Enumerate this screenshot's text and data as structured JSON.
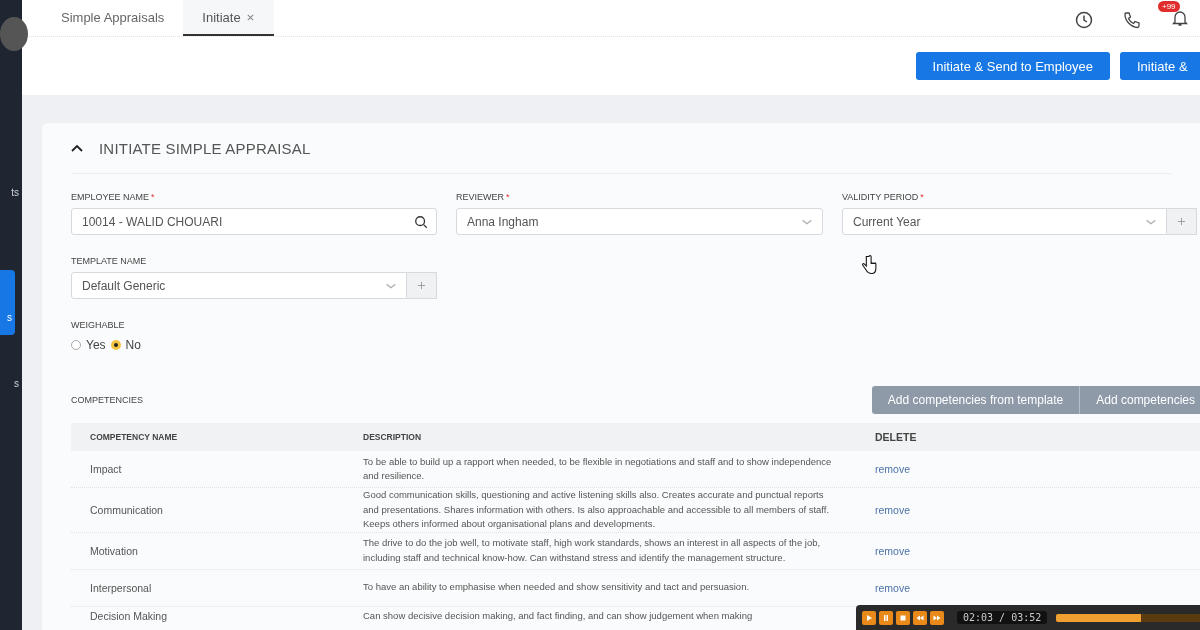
{
  "sidebar": {
    "items": [
      {
        "label": "ts",
        "selected": false
      },
      {
        "label": "s",
        "selected": true
      },
      {
        "label": "s",
        "selected": false
      }
    ]
  },
  "tabs": [
    {
      "label": "Simple Appraisals",
      "selected": false,
      "closable": false
    },
    {
      "label": "Initiate",
      "selected": true,
      "closable": true
    }
  ],
  "notification_badge": "+99",
  "actions": [
    "Initiate & Send to Employee",
    "Initiate &"
  ],
  "section": {
    "title": "INITIATE SIMPLE APPRAISAL",
    "expanded": true
  },
  "fields": [
    {
      "label": "EMPLOYEE NAME",
      "required_mark": "*",
      "value": "10014 - WALID CHOUARI",
      "kind": "search",
      "addable": false
    },
    {
      "label": "REVIEWER",
      "required_mark": "*",
      "value": "Anna Ingham",
      "kind": "select",
      "addable": false
    },
    {
      "label": "VALIDITY PERIOD",
      "required_mark": "*",
      "value": "Current Year",
      "kind": "select",
      "addable": true
    },
    {
      "label": "TEMPLATE NAME",
      "value": "Default Generic",
      "kind": "select",
      "addable": true
    }
  ],
  "weighable": {
    "label": "WEIGHABLE",
    "options": [
      {
        "label": "Yes",
        "selected": false
      },
      {
        "label": "No",
        "selected": true
      }
    ]
  },
  "competencies": {
    "label": "COMPETENCIES",
    "buttons": [
      "Add competencies from template",
      "Add competencies"
    ],
    "columns": [
      "COMPETENCY NAME",
      "DESCRIPTION",
      "DELETE"
    ],
    "rows": [
      {
        "name": "Impact",
        "description": "To be able to build up a rapport when needed, to be flexible in negotiations and staff and to show independence and resilience.",
        "action": "remove"
      },
      {
        "name": "Communication",
        "description": "Good communication skills, questioning and active listening skills also. Creates accurate and punctual reports and presentations. Shares information with others. Is also approachable and accessible to all members of staff. Keeps others informed about organisational plans and developments.",
        "action": "remove"
      },
      {
        "name": "Motivation",
        "description": "The drive to do the job well, to motivate staff, high work standards, shows an interest in all aspects of the job, including staff and technical know-how. Can withstand stress and identify the management structure.",
        "action": "remove"
      },
      {
        "name": "Interpersonal",
        "description": "To have an ability to emphasise when needed and show sensitivity and tact and persuasion.",
        "action": "remove"
      },
      {
        "name": "Decision Making",
        "description": "Can show decisive decision making, and fact finding, and can show judgement when making",
        "action": ""
      }
    ]
  },
  "player": {
    "time": "02:03 / 03:52",
    "level": 0.53
  }
}
